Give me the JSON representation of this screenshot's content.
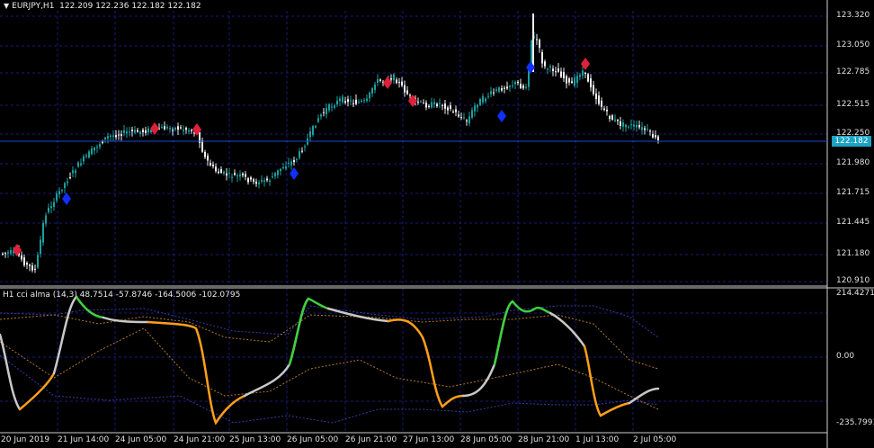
{
  "header": {
    "symbol_timeframe": "EURJPY,H1",
    "ohlc": "122.209 122.236 122.182 122.182"
  },
  "indicator": {
    "title": "H1 cci alma (14,3) 48.7514 -57.8746 -164.5006 -102.0795"
  },
  "current_price": "122.182",
  "price_axis": [
    "123.320",
    "123.050",
    "122.785",
    "122.515",
    "122.250",
    "121.980",
    "121.715",
    "121.445",
    "121.180",
    "120.910"
  ],
  "indicator_axis": [
    "214.4271",
    "0.00",
    "-235.7993"
  ],
  "time_axis": [
    "20 Jun 2019",
    "21 Jun 14:00",
    "24 Jun 05:00",
    "24 Jun 21:00",
    "25 Jun 13:00",
    "26 Jun 05:00",
    "26 Jun 21:00",
    "27 Jun 13:00",
    "28 Jun 05:00",
    "28 Jun 21:00",
    "1 Jul 13:00",
    "2 Jul 05:00"
  ],
  "colors": {
    "background": "#000000",
    "grid": "#1a1a7a",
    "bull": "#1b9f9f",
    "bear": "#f0f0f0",
    "sell_signal": "#e0203a",
    "buy_signal": "#1030ff",
    "cci_up": "#3ecf3e",
    "cci_down": "#ff9f1a",
    "cci_flat": "#c8c8c8",
    "band_outer": "#3a3aa8",
    "band_inner": "#b07a2a",
    "price_line": "#1a4ad6"
  },
  "icons": {
    "dropdown": "triangle-down-icon"
  }
}
